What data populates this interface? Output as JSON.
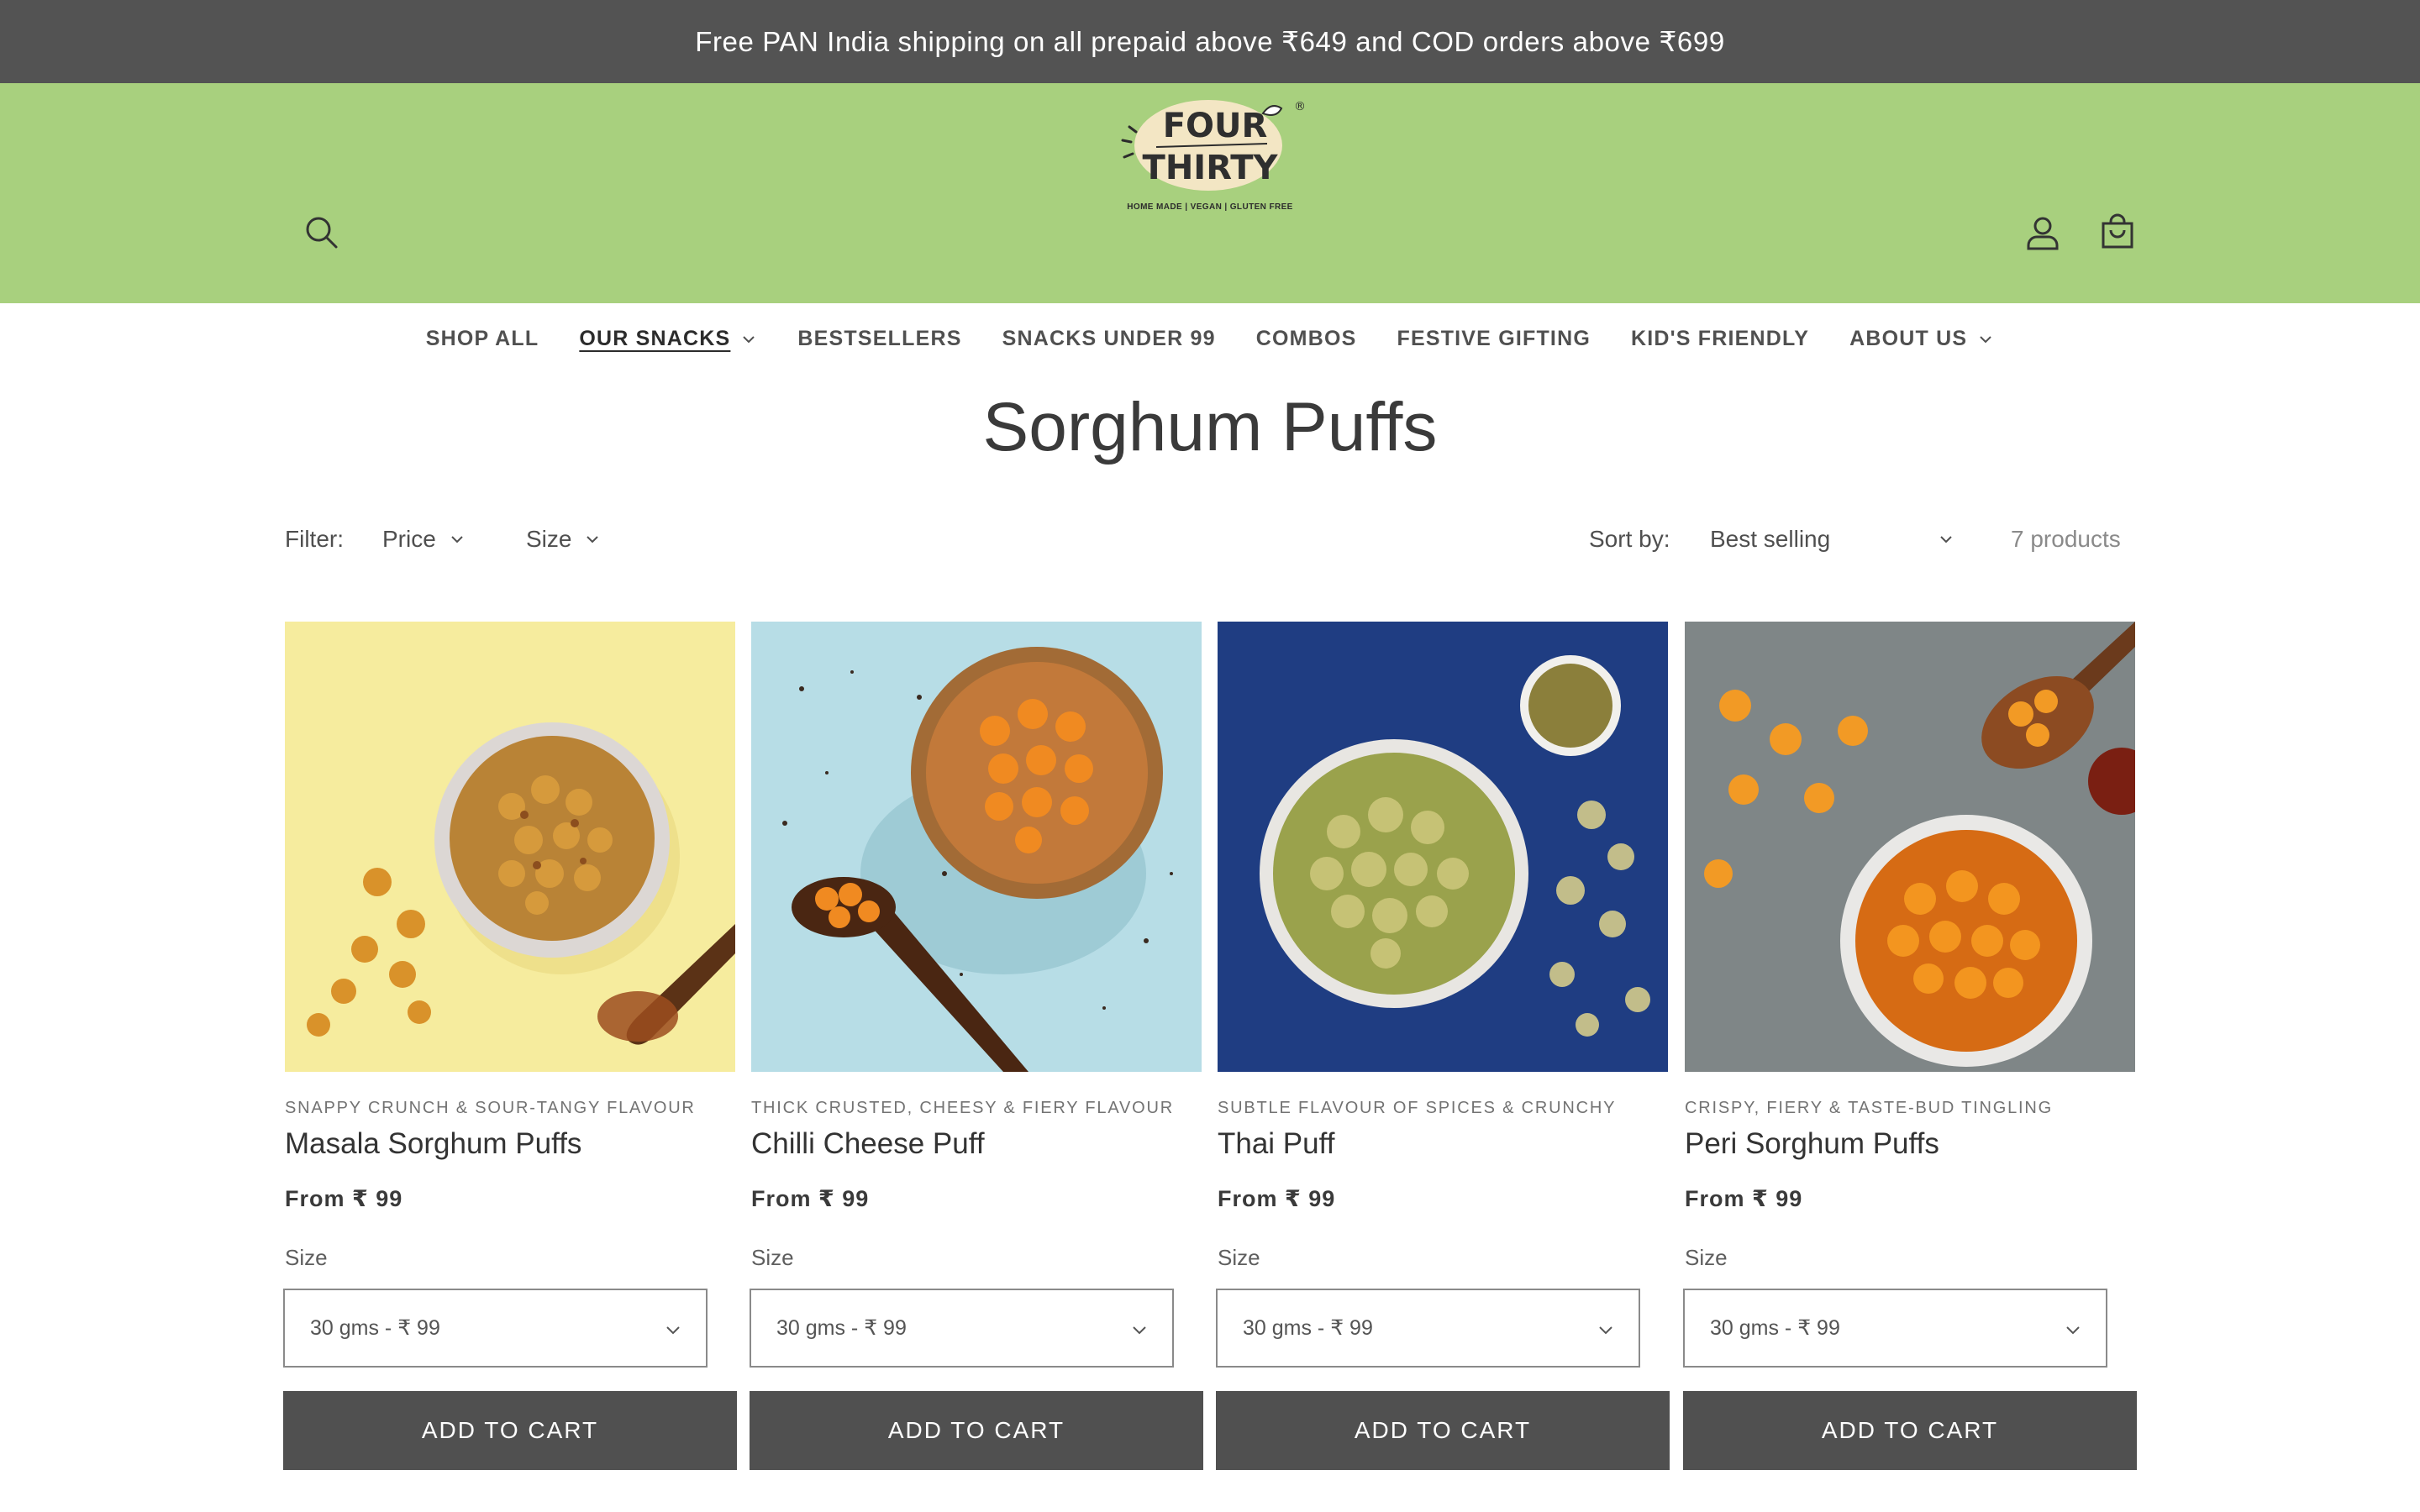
{
  "announcement": "Free PAN India shipping on all prepaid above ₹649 and COD orders above ₹699",
  "header": {
    "logo": {
      "line1": "FOUR",
      "line2": "THIRTY",
      "registered": "®",
      "tagline": "HOME MADE | VEGAN | GLUTEN FREE"
    },
    "icons": {
      "search": "search-icon",
      "account": "user-icon",
      "cart": "cart-icon"
    }
  },
  "nav": [
    {
      "label": "SHOP ALL",
      "has_dropdown": false,
      "active": false
    },
    {
      "label": "OUR SNACKS",
      "has_dropdown": true,
      "active": true
    },
    {
      "label": "BESTSELLERS",
      "has_dropdown": false,
      "active": false
    },
    {
      "label": "SNACKS UNDER 99",
      "has_dropdown": false,
      "active": false
    },
    {
      "label": "COMBOS",
      "has_dropdown": false,
      "active": false
    },
    {
      "label": "FESTIVE GIFTING",
      "has_dropdown": false,
      "active": false
    },
    {
      "label": "KID'S FRIENDLY",
      "has_dropdown": false,
      "active": false
    },
    {
      "label": "ABOUT US",
      "has_dropdown": true,
      "active": false
    }
  ],
  "page_title": "Sorghum Puffs",
  "filters": {
    "label": "Filter:",
    "price": "Price",
    "size": "Size",
    "sort_label": "Sort by:",
    "sort_value": "Best selling",
    "count": "7 products"
  },
  "products": [
    {
      "tagline": "SNAPPY CRUNCH & SOUR-TANGY FLAVOUR",
      "name": "Masala Sorghum Puffs",
      "price": "From ₹ 99",
      "size_label": "Size",
      "size_value": "30 gms - ₹ 99",
      "button": "ADD TO CART"
    },
    {
      "tagline": "THICK CRUSTED, CHEESY & FIERY FLAVOUR",
      "name": "Chilli Cheese Puff",
      "price": "From ₹ 99",
      "size_label": "Size",
      "size_value": "30 gms - ₹ 99",
      "button": "ADD TO CART"
    },
    {
      "tagline": "SUBTLE FLAVOUR OF SPICES & CRUNCHY",
      "name": "Thai Puff",
      "price": "From ₹ 99",
      "size_label": "Size",
      "size_value": "30 gms - ₹ 99",
      "button": "ADD TO CART"
    },
    {
      "tagline": "CRISPY, FIERY & TASTE-BUD TINGLING",
      "name": "Peri Sorghum Puffs",
      "price": "From ₹ 99",
      "size_label": "Size",
      "size_value": "30 gms - ₹ 99",
      "button": "ADD TO CART"
    }
  ],
  "colors": {
    "announcement_bg": "#535353",
    "header_bg": "#a8d07e",
    "button_bg": "#505050"
  }
}
